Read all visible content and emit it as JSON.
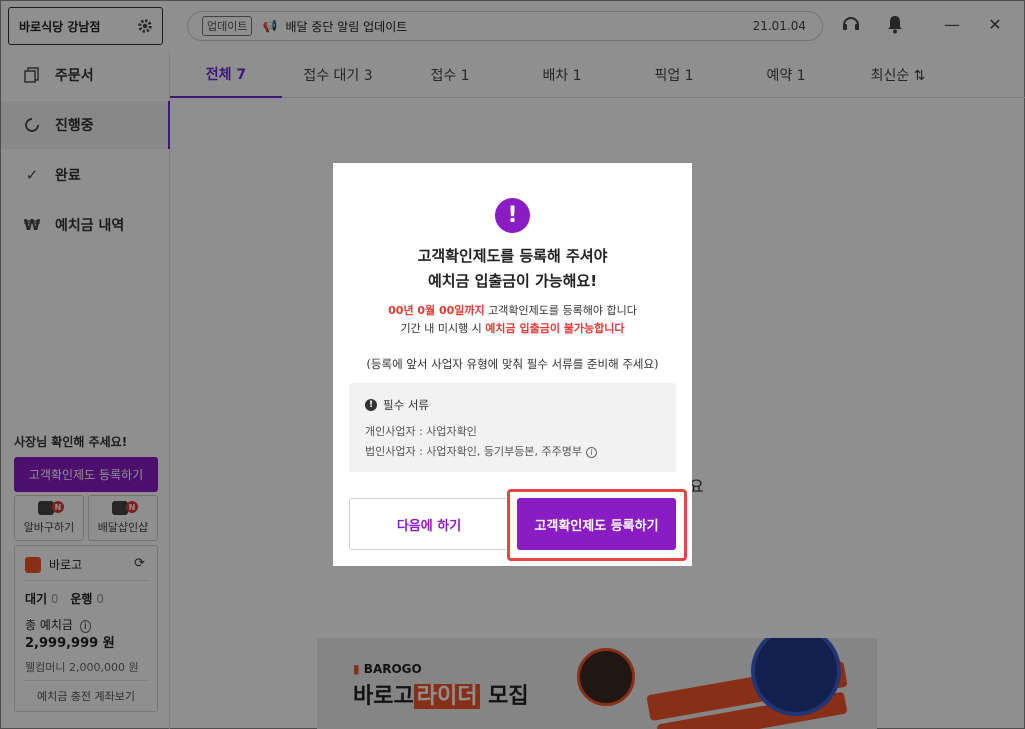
{
  "store": {
    "name": "바로식당 강남점"
  },
  "sidebar": {
    "items": [
      {
        "label": "주문서",
        "icon": "copy-icon"
      },
      {
        "label": "진행중",
        "icon": "spinner-icon"
      },
      {
        "label": "완료",
        "icon": "check-icon"
      },
      {
        "label": "예치금 내역",
        "icon": "won-icon"
      }
    ],
    "notice_title": "사장님 확인해 주세요!",
    "register_button": "고객확인제도 등록하기",
    "mini_buttons": [
      {
        "label": "알바구하기",
        "badge": "N",
        "icon": "worker-icon"
      },
      {
        "label": "배달샵인샵",
        "badge": "N",
        "icon": "shop-icon"
      }
    ],
    "wallet": {
      "brand": "바로고",
      "stats_waiting_label": "대기",
      "stats_waiting_value": "0",
      "stats_running_label": "운행",
      "stats_running_value": "0",
      "deposit_label": "총 예치금",
      "deposit_amount": "2,999,999 원",
      "welcome_money": "웰컴머니 2,000,000 원",
      "account_link": "예치금 충전 계좌보기"
    }
  },
  "topbar": {
    "tag": "업데이트",
    "title": "배달 중단 알림 업데이트",
    "date": "21.01.04"
  },
  "tabs": [
    {
      "label": "전체 7",
      "active": true
    },
    {
      "label": "접수 대기 3"
    },
    {
      "label": "접수 1"
    },
    {
      "label": "배차 1"
    },
    {
      "label": "픽업 1"
    },
    {
      "label": "예약 1"
    },
    {
      "label": "최신순 ⇅"
    }
  ],
  "background_fragment": "요",
  "banner": {
    "logo": "BAROGO",
    "text_prefix": "바로고",
    "text_highlight": "라이더",
    "text_suffix": "모집"
  },
  "modal": {
    "title_line1": "고객확인제도를 등록해 주셔야",
    "title_line2": "예치금 입출금이 가능해요!",
    "deadline_red": "00년 0월 00일까지",
    "deadline_rest": " 고객확인제도를 등록해야 합니다",
    "warning_prefix": "기간 내 미시행 시 ",
    "warning_red": "예치금 입출금이 불가능합니다",
    "note": "(등록에 앞서 사업자 유형에 맞춰 필수 서류를 준비해 주세요)",
    "required_title": "필수 서류",
    "individual": "개인사업자 : 사업자확인",
    "corporate": "법인사업자 : 사업자확인, 등기부등본, 주주명부",
    "later_button": "다음에 하기",
    "register_button": "고객확인제도 등록하기"
  },
  "colors": {
    "accent": "#8a1cc4",
    "warning": "#e53935",
    "highlight": "#e44545"
  }
}
